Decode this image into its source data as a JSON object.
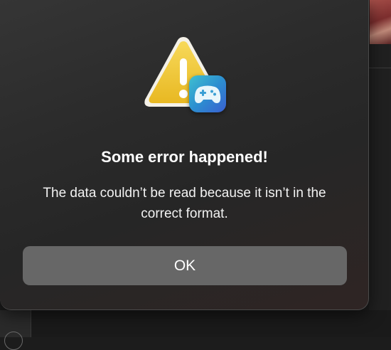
{
  "alert": {
    "title": "Some error happened!",
    "message": "The data couldn’t be read because it isn’t in the correct format.",
    "ok_label": "OK",
    "icons": {
      "main": "caution-triangle-icon",
      "badge": "game-controller-app-icon"
    }
  },
  "colors": {
    "sheet_background": "#2b2b2b",
    "button_background": "#676767",
    "caution_yellow": "#f2c531",
    "badge_gradient_start": "#3fc0d0",
    "badge_gradient_end": "#3a5fd0",
    "text": "#ffffff"
  }
}
